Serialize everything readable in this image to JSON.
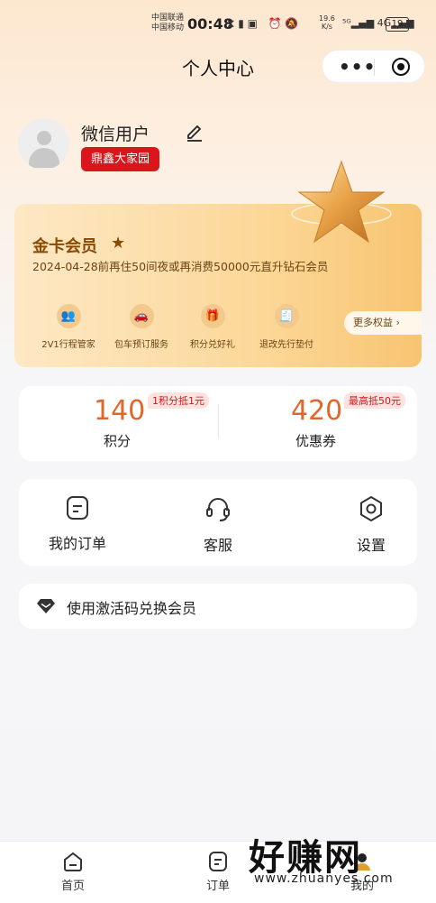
{
  "status": {
    "carrier1": "中国联通",
    "carrier2": "中国移动",
    "time": "00:48",
    "speed1": "19.6",
    "speed2": "K/s",
    "battery": "19",
    "net": "4G"
  },
  "header": {
    "title": "个人中心",
    "more": "•••"
  },
  "profile": {
    "name": "微信用户",
    "tag": "鼎鑫大家园"
  },
  "member": {
    "title": "金卡会员",
    "star": "★",
    "subtitle": "2024-04-28前再住50间夜或再消费50000元直升钻石会员",
    "benefits": [
      {
        "label": "2V1行程管家",
        "icon": "people-icon"
      },
      {
        "label": "包车预订服务",
        "icon": "car-icon"
      },
      {
        "label": "积分兑好礼",
        "icon": "gift-icon"
      },
      {
        "label": "退改先行垫付",
        "icon": "receipt-icon"
      }
    ],
    "more": "更多权益 ›"
  },
  "points": {
    "value": "140",
    "label": "积分",
    "chip": "1积分抵1元"
  },
  "coupons": {
    "value": "420",
    "label": "优惠券",
    "chip": "最高抵50元"
  },
  "menu": [
    {
      "label": "我的订单",
      "icon": "order-icon"
    },
    {
      "label": "客服",
      "icon": "headset-icon"
    },
    {
      "label": "设置",
      "icon": "gear-icon"
    }
  ],
  "activation": {
    "label": "使用激活码兑换会员",
    "icon": "diamond-icon"
  },
  "tabs": [
    {
      "label": "首页",
      "icon": "home-icon"
    },
    {
      "label": "订单",
      "icon": "order-icon"
    },
    {
      "label": "我的",
      "icon": "user-icon"
    }
  ],
  "watermark": {
    "text": "好赚网",
    "url": "www.zhuanyes.com"
  },
  "colors": {
    "accent": "#e0662a",
    "tag": "#d9161b",
    "gold": "#8a4a05"
  }
}
